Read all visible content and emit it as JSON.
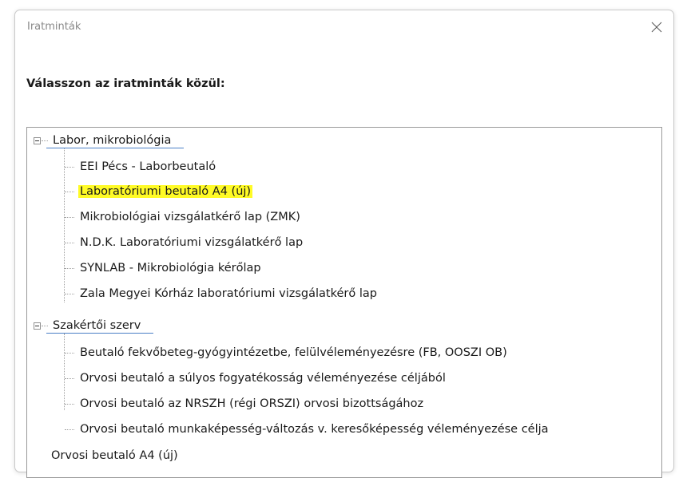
{
  "window": {
    "title": "Iratminták"
  },
  "prompt": "Válasszon az iratminták közül:",
  "tree": {
    "groups": [
      {
        "label": "Labor, mikrobiológia",
        "items": [
          "EEI Pécs - Laborbeutaló",
          "Laboratóriumi beutaló A4 (új)",
          "Mikrobiológiai vizsgálatkérő lap (ZMK)",
          "N.D.K. Laboratóriumi vizsgálatkérő lap",
          "SYNLAB - Mikrobiológia kérőlap",
          "Zala Megyei Kórház laboratóriumi vizsgálatkérő lap"
        ]
      },
      {
        "label": "Szakértői szerv",
        "items": [
          "Beutaló fekvőbeteg-gyógyintézetbe, felülvéleményezésre (FB, OOSZI OB)",
          "Orvosi beutaló a súlyos fogyatékosság véleményezése céljából",
          "Orvosi beutaló az NRSZH (régi ORSZI) orvosi bizottságához",
          "Orvosi beutaló munkaképesség-változás v. keresőképesség véleményezése célja"
        ]
      }
    ],
    "root_item": "Orvosi beutaló A4 (új)"
  },
  "colors": {
    "highlight": "#fffb26",
    "underline": "#4a7fc6"
  }
}
